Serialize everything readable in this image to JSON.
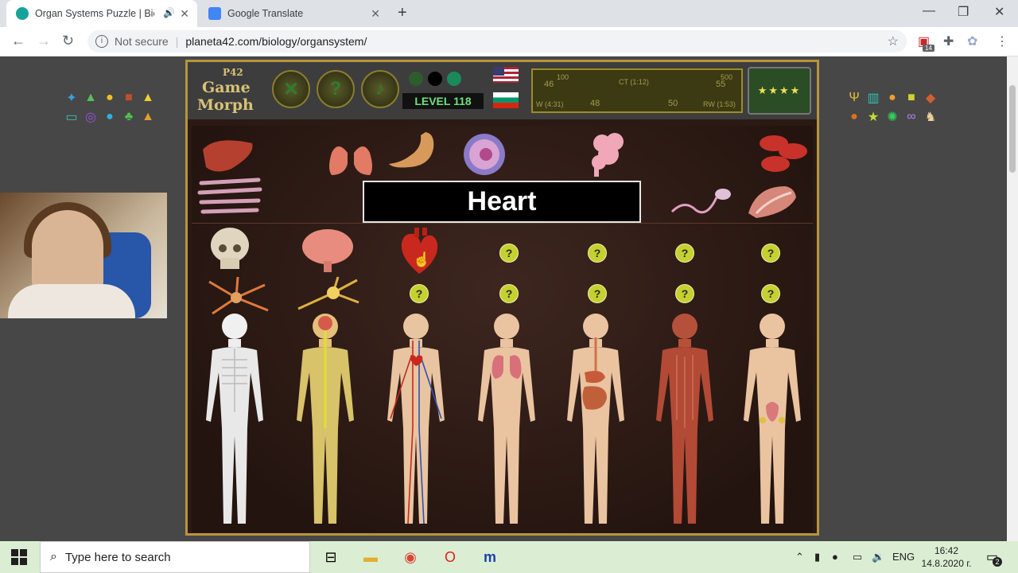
{
  "browser": {
    "tabs": [
      {
        "title": "Organ Systems Puzzle | Biolo",
        "active": true
      },
      {
        "title": "Google Translate",
        "active": false
      }
    ],
    "security": "Not secure",
    "url": "planeta42.com/biology/organsystem/",
    "extension_badge": "14"
  },
  "game": {
    "logo_top": "P42",
    "logo_line1": "Game",
    "logo_line2": "Morph",
    "level": "LEVEL 118",
    "score": {
      "left_top": "46",
      "left_top_small": "100",
      "middle": "CT (1:12)",
      "right_top": "55",
      "right_top_small": "500",
      "bottom_left": "W (4:31)",
      "bottom_mid1": "48",
      "bottom_mid2": "50",
      "bottom_right": "RW (1:53)"
    },
    "current_label": "Heart",
    "hint_marks": [
      "?",
      "?",
      "?",
      "?",
      "?",
      "?",
      "?",
      "?",
      "?"
    ]
  },
  "taskbar": {
    "search_placeholder": "Type here to search",
    "language": "ENG",
    "time": "16:42",
    "date": "14.8.2020 г.",
    "notifications": "2"
  },
  "colors": {
    "frame_gold": "#b6953c",
    "level_green": "#6ee07a",
    "hint_yellow": "#c5d032"
  }
}
